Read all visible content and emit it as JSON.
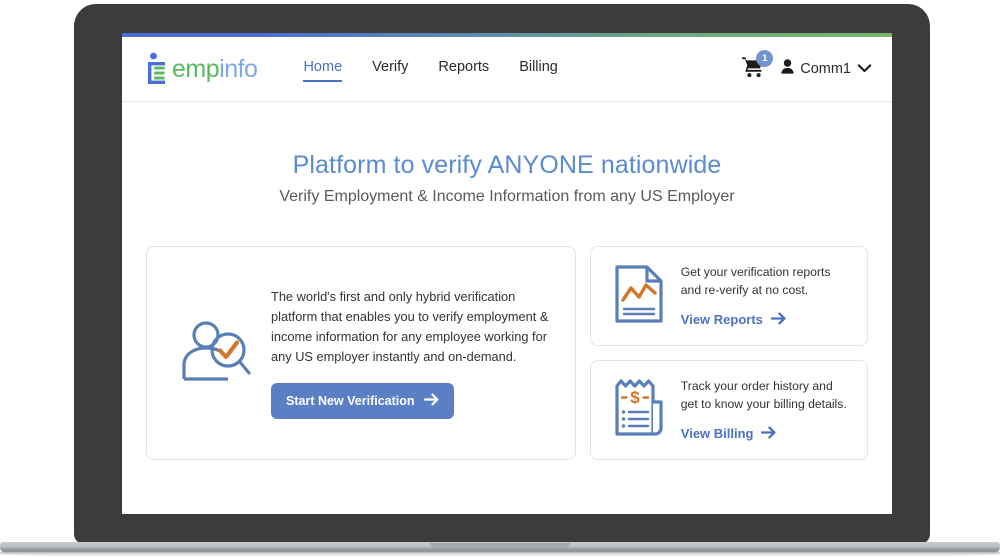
{
  "brand": {
    "name_green": "emp",
    "name_blue": "info",
    "logo_icon": "empinfo-e-logo"
  },
  "nav": {
    "items": [
      {
        "label": "Home",
        "active": true
      },
      {
        "label": "Verify",
        "active": false
      },
      {
        "label": "Reports",
        "active": false
      },
      {
        "label": "Billing",
        "active": false
      }
    ]
  },
  "header_right": {
    "cart_icon": "shopping-cart-icon",
    "cart_count": "1",
    "user_icon": "person-icon",
    "user_name": "Comm1",
    "chevron_icon": "chevron-down-icon"
  },
  "hero": {
    "title": "Platform to verify ANYONE nationwide",
    "subtitle": "Verify Employment & Income Information from any US Employer"
  },
  "main_card": {
    "illustration": "person-with-magnifier-check-icon",
    "copy": "The world's first and only hybrid verification platform that enables you to verify employment & income information for any employee working for any US employer instantly and on-demand.",
    "button_label": "Start New Verification",
    "button_arrow": "arrow-right-icon"
  },
  "side_cards": [
    {
      "illustration": "report-document-chart-icon",
      "copy": "Get your verification reports and re-verify at no cost.",
      "link_label": "View Reports",
      "link_arrow": "arrow-right-icon"
    },
    {
      "illustration": "billing-receipt-dollar-icon",
      "copy": "Track your order history and get to know your billing details.",
      "link_label": "View Billing",
      "link_arrow": "arrow-right-icon"
    }
  ],
  "colors": {
    "accent_blue": "#4a72c4",
    "hero_blue": "#5b8bd0",
    "brand_green": "#5cb85c",
    "brand_blue": "#7fa8e8",
    "button_blue": "#5a7fc4",
    "icon_orange": "#d2762a",
    "icon_blue": "#5a7fb8",
    "badge_blue": "#7494cf",
    "laptop_body": "#3c3c3c"
  }
}
